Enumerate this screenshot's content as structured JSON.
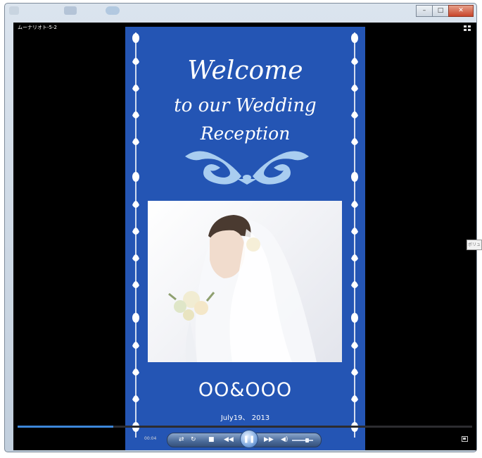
{
  "window": {
    "title": "ムーナリオト-5-2",
    "minimize_glyph": "–",
    "maximize_glyph": "□",
    "close_glyph": "✕"
  },
  "poster": {
    "welcome_line1": "Welcome",
    "welcome_line2": "to our Wedding",
    "welcome_line3": "Reception",
    "couple_names": "OO&OOO",
    "date": "July19、 2013"
  },
  "player": {
    "elapsed_time": "00:04",
    "progress_fraction": 0.21,
    "volume_fraction": 0.7,
    "side_label": "ボリュ",
    "icons": {
      "shuffle": "shuffle-icon",
      "repeat": "repeat-icon",
      "stop": "stop-icon",
      "previous": "previous-icon",
      "play_pause": "pause-icon",
      "next": "next-icon",
      "mute": "speaker-icon",
      "fullscreen": "switch-to-library-icon"
    }
  },
  "colors": {
    "poster_blue": "#2455b4",
    "seek_fill": "#3d86d9",
    "ornament": "#a9cdf0"
  }
}
